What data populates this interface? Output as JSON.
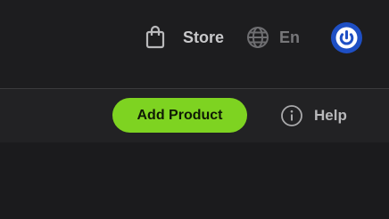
{
  "header": {
    "store": {
      "label": "Store",
      "icon": "shopping-bag-icon"
    },
    "language": {
      "label": "En",
      "icon": "globe-icon"
    },
    "avatar": {
      "icon": "power-icon",
      "color": "#1e4fc4"
    }
  },
  "toolbar": {
    "add_product_label": "Add Product",
    "add_product_color": "#7ed321",
    "help": {
      "label": "Help",
      "icon": "info-icon"
    }
  }
}
